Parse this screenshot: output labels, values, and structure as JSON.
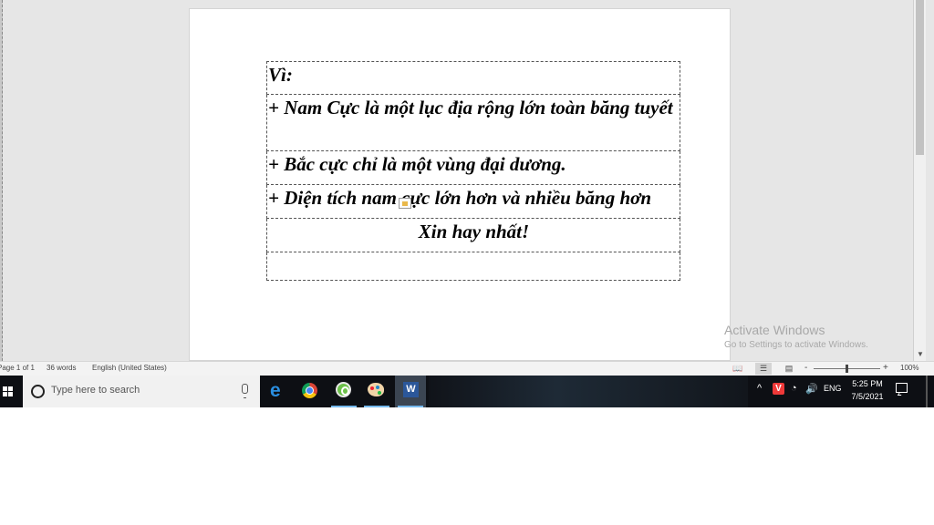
{
  "document": {
    "rows": [
      "Vì:",
      "+ Nam Cực là một lục địa rộng lớn toàn băng tuyết",
      "+ Bắc cực chỉ là một vùng đại dương.",
      "+ Diện tích nam cực lớn hơn và nhiều băng hơn",
      "Xin hay nhất!",
      ""
    ]
  },
  "watermark": {
    "title": "Activate Windows",
    "subtitle": "Go to Settings to activate Windows."
  },
  "statusbar": {
    "page": "Page 1 of 1",
    "words": "36 words",
    "language": "English (United States)",
    "zoom": "100%",
    "zoom_fraction": 0.5,
    "zoom_minus": "-",
    "zoom_plus": "+"
  },
  "taskbar": {
    "search_placeholder": "Type here to search",
    "language": "ENG",
    "time": "5:25 PM",
    "date": "7/5/2021",
    "apps": [
      "edge-icon",
      "chrome-icon",
      "green-app-icon",
      "paint-icon",
      "word-icon"
    ]
  }
}
